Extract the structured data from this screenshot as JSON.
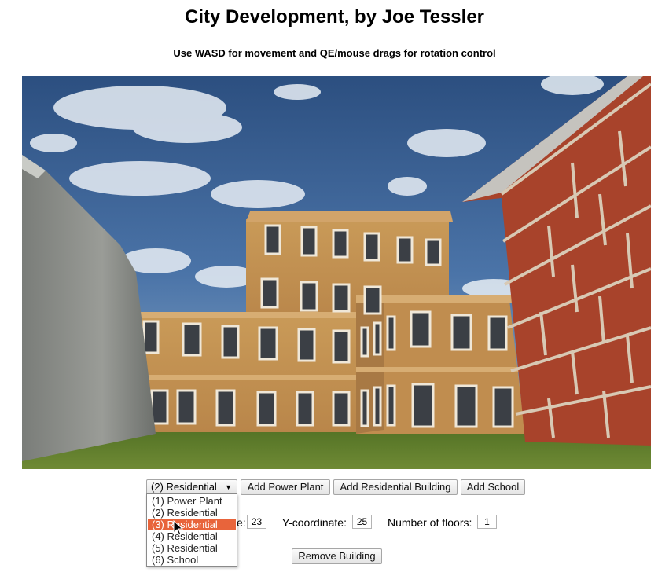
{
  "title": "City Development, by Joe Tessler",
  "instructions": "Use WASD for movement and QE/mouse drags for rotation control",
  "scene": {
    "sky_color": "#3f6392",
    "grass_color": "#5b7a29",
    "brick_color": "#a8432b",
    "building_color": "#c79550",
    "rock_color": "#8a8d88"
  },
  "controls": {
    "building_select": {
      "value": "(2) Residential",
      "options": [
        "(1) Power Plant",
        "(2) Residential",
        "(3) Residential",
        "(4) Residential",
        "(5) Residential",
        "(6) School"
      ],
      "highlighted": "(3) Residential"
    },
    "add_power_plant": "Add Power Plant",
    "add_residential": "Add Residential Building",
    "add_school": "Add School",
    "x_label_visible": "e:",
    "x_value": "23",
    "y_label": "Y-coordinate:",
    "y_value": "25",
    "floors_label": "Number of floors:",
    "floors_value": "1",
    "remove_building": "Remove Building"
  }
}
